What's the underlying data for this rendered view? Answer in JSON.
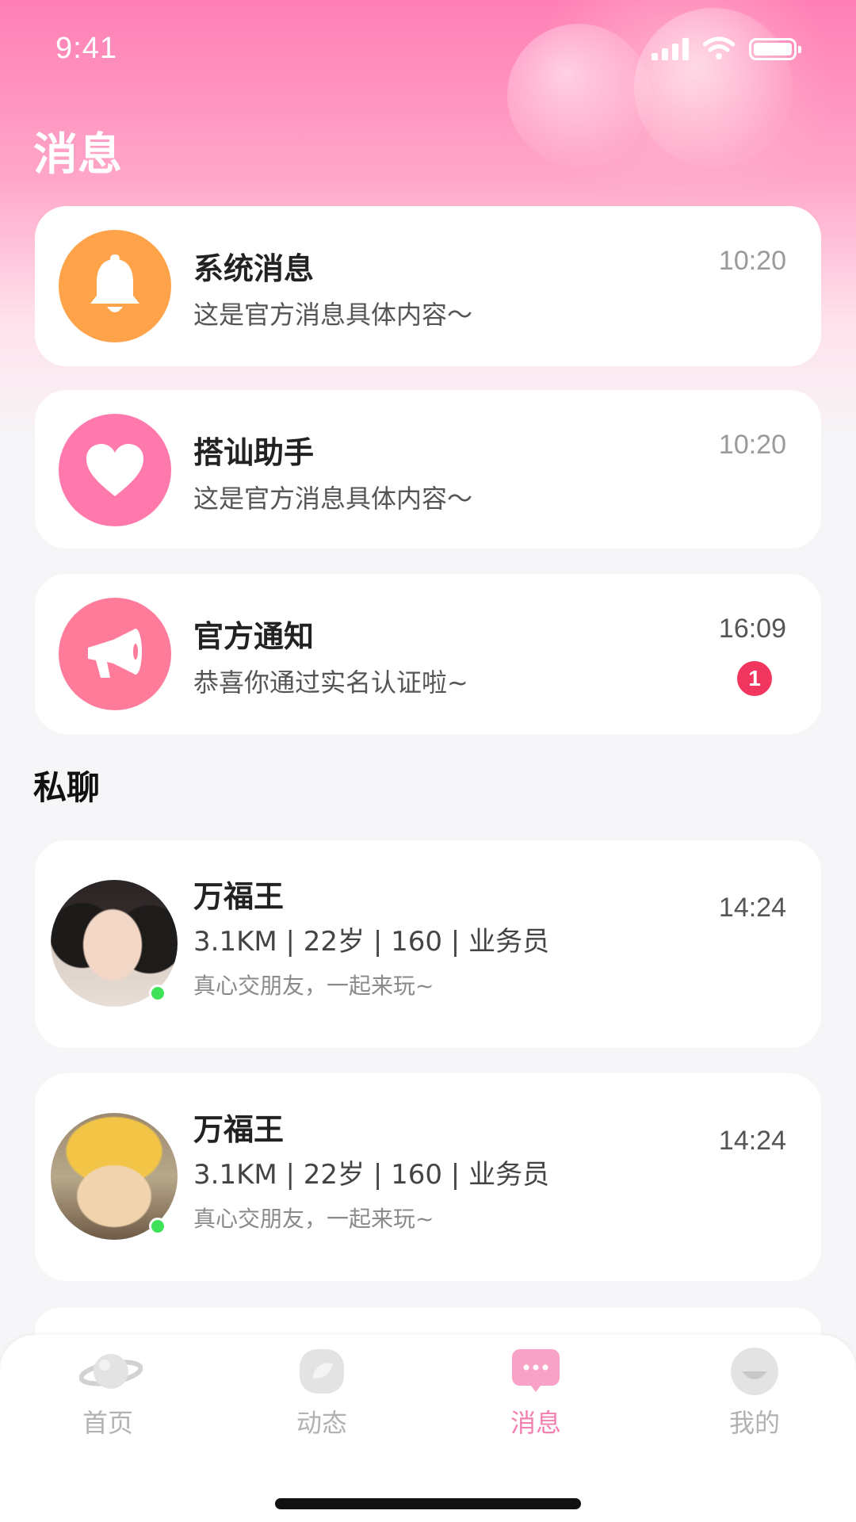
{
  "status_bar": {
    "time": "9:41"
  },
  "header": {
    "title": "消息"
  },
  "system_messages": [
    {
      "title": "系统消息",
      "preview": "这是官方消息具体内容～",
      "time": "10:20",
      "icon": "bell-icon",
      "color": "#ffa34a"
    },
    {
      "title": "搭讪助手",
      "preview": "这是官方消息具体内容～",
      "time": "10:20",
      "icon": "heart-icon",
      "color": "#ff79ac"
    },
    {
      "title": "官方通知",
      "preview": "恭喜你通过实名认证啦~",
      "time": "16:09",
      "icon": "megaphone-icon",
      "color": "#ff7b9a",
      "badge": "1"
    }
  ],
  "private_chat": {
    "section_title": "私聊",
    "items": [
      {
        "name": "万福王",
        "info": "3.1KM | 22岁 | 160 | 业务员",
        "motto": "真心交朋友，一起来玩~",
        "time": "14:24",
        "online": true,
        "avatar": "girl-avatar"
      },
      {
        "name": "万福王",
        "info": "3.1KM | 22岁 | 160 | 业务员",
        "motto": "真心交朋友，一起来玩~",
        "time": "14:24",
        "online": true,
        "avatar": "cat-avatar"
      }
    ]
  },
  "tabbar": {
    "active": "消息",
    "accent": "#f27fb0",
    "tabs": [
      {
        "label": "首页",
        "icon": "planet-icon"
      },
      {
        "label": "动态",
        "icon": "moments-icon"
      },
      {
        "label": "消息",
        "icon": "message-icon"
      },
      {
        "label": "我的",
        "icon": "profile-icon"
      }
    ]
  }
}
